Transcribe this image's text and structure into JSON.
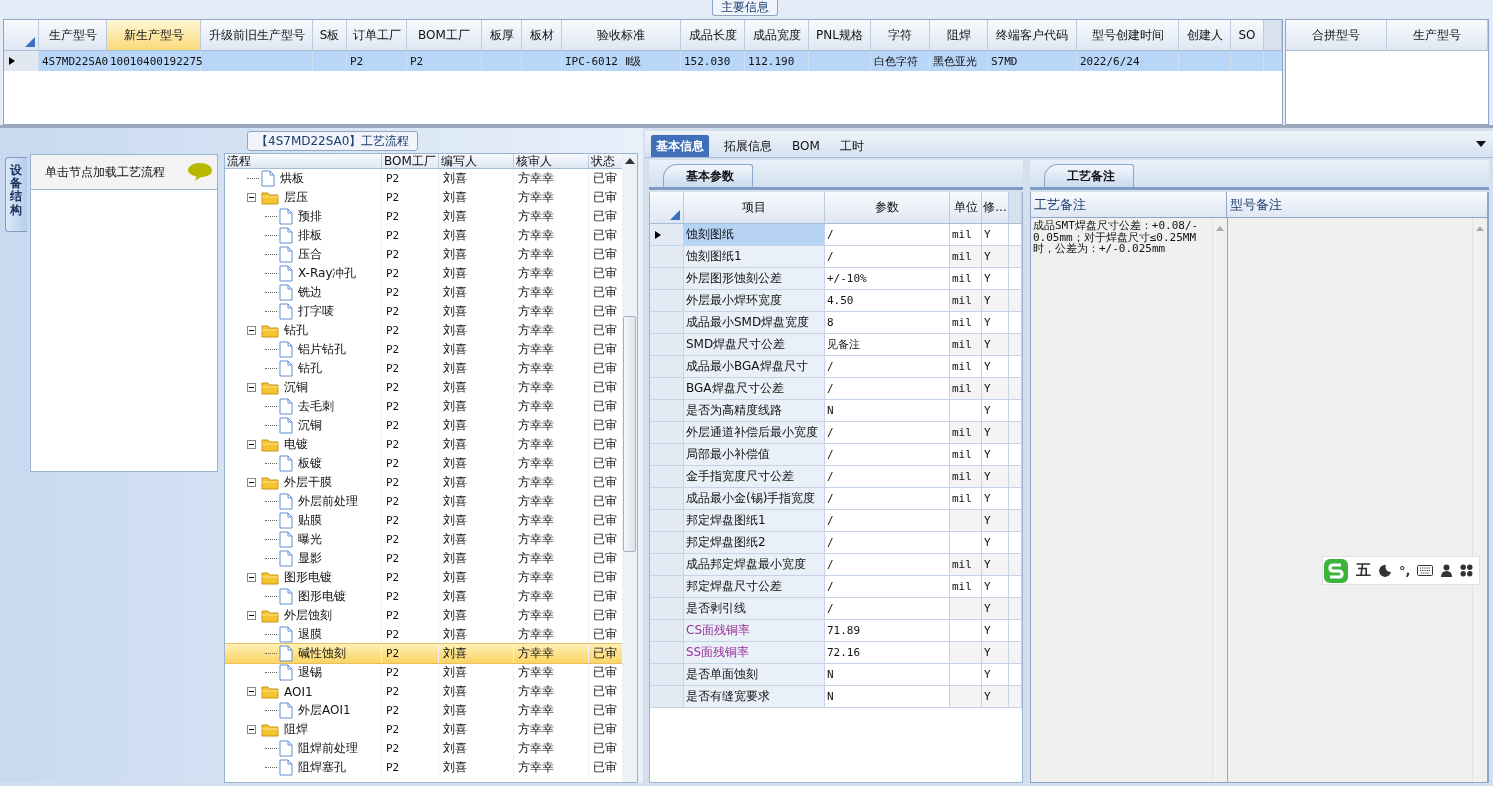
{
  "main_info": {
    "title": "主要信息",
    "columns": [
      {
        "label": "生产型号",
        "highlighted": false
      },
      {
        "label": "新生产型号",
        "highlighted": true
      },
      {
        "label": "升级前旧生产型号",
        "highlighted": false
      },
      {
        "label": "S板",
        "highlighted": false
      },
      {
        "label": "订单工厂",
        "highlighted": false
      },
      {
        "label": "BOM工厂",
        "highlighted": false
      },
      {
        "label": "板厚",
        "highlighted": false
      },
      {
        "label": "板材",
        "highlighted": false
      },
      {
        "label": "验收标准",
        "highlighted": false
      },
      {
        "label": "成品长度",
        "highlighted": false
      },
      {
        "label": "成品宽度",
        "highlighted": false
      },
      {
        "label": "PNL规格",
        "highlighted": false
      },
      {
        "label": "字符",
        "highlighted": false
      },
      {
        "label": "阻焊",
        "highlighted": false
      },
      {
        "label": "终端客户代码",
        "highlighted": false
      },
      {
        "label": "型号创建时间",
        "highlighted": false
      },
      {
        "label": "创建人",
        "highlighted": false
      },
      {
        "label": "SO",
        "highlighted": false
      }
    ],
    "rows": [
      {
        "selected": true,
        "cells": [
          "4S7MD22SA0",
          "10010400192275",
          null,
          null,
          "P2",
          "P2",
          null,
          null,
          "IPC-6012 Ⅱ级",
          "152.030",
          "112.190",
          null,
          "白色字符",
          "黑色亚光",
          "S7MD",
          "2022/6/24",
          null,
          null
        ]
      }
    ],
    "side_columns": [
      "合拼型号",
      "生产型号"
    ]
  },
  "left_tab": "设备结构",
  "process": {
    "title": "【4S7MD22SA0】工艺流程",
    "hint": "单击节点加载工艺流程",
    "columns": [
      "流程",
      "BOM工厂",
      "编写人",
      "核审人",
      "状态"
    ],
    "tree": [
      {
        "kind": "step",
        "label": "烘板",
        "bom": "P2",
        "writer": "刘喜",
        "reviewer": "方幸幸",
        "status": "已审",
        "selected": false
      },
      {
        "kind": "folder",
        "label": "层压",
        "bom": "P2",
        "writer": "刘喜",
        "reviewer": "方幸幸",
        "status": "已审",
        "selected": false,
        "expanded": true,
        "children": [
          {
            "kind": "step",
            "label": "预排",
            "bom": "P2",
            "writer": "刘喜",
            "reviewer": "方幸幸",
            "status": "已审",
            "selected": false
          },
          {
            "kind": "step",
            "label": "排板",
            "bom": "P2",
            "writer": "刘喜",
            "reviewer": "方幸幸",
            "status": "已审",
            "selected": false
          },
          {
            "kind": "step",
            "label": "压合",
            "bom": "P2",
            "writer": "刘喜",
            "reviewer": "方幸幸",
            "status": "已审",
            "selected": false
          },
          {
            "kind": "step",
            "label": "X-Ray冲孔",
            "bom": "P2",
            "writer": "刘喜",
            "reviewer": "方幸幸",
            "status": "已审",
            "selected": false
          },
          {
            "kind": "step",
            "label": "铣边",
            "bom": "P2",
            "writer": "刘喜",
            "reviewer": "方幸幸",
            "status": "已审",
            "selected": false
          },
          {
            "kind": "step",
            "label": "打字唛",
            "bom": "P2",
            "writer": "刘喜",
            "reviewer": "方幸幸",
            "status": "已审",
            "selected": false
          }
        ]
      },
      {
        "kind": "folder",
        "label": "钻孔",
        "bom": "P2",
        "writer": "刘喜",
        "reviewer": "方幸幸",
        "status": "已审",
        "selected": false,
        "expanded": true,
        "children": [
          {
            "kind": "step",
            "label": "铝片钻孔",
            "bom": "P2",
            "writer": "刘喜",
            "reviewer": "方幸幸",
            "status": "已审",
            "selected": false
          },
          {
            "kind": "step",
            "label": "钻孔",
            "bom": "P2",
            "writer": "刘喜",
            "reviewer": "方幸幸",
            "status": "已审",
            "selected": false
          }
        ]
      },
      {
        "kind": "folder",
        "label": "沉铜",
        "bom": "P2",
        "writer": "刘喜",
        "reviewer": "方幸幸",
        "status": "已审",
        "selected": false,
        "expanded": true,
        "children": [
          {
            "kind": "step",
            "label": "去毛刺",
            "bom": "P2",
            "writer": "刘喜",
            "reviewer": "方幸幸",
            "status": "已审",
            "selected": false
          },
          {
            "kind": "step",
            "label": "沉铜",
            "bom": "P2",
            "writer": "刘喜",
            "reviewer": "方幸幸",
            "status": "已审",
            "selected": false
          }
        ]
      },
      {
        "kind": "folder",
        "label": "电镀",
        "bom": "P2",
        "writer": "刘喜",
        "reviewer": "方幸幸",
        "status": "已审",
        "selected": false,
        "expanded": true,
        "children": [
          {
            "kind": "step",
            "label": "板镀",
            "bom": "P2",
            "writer": "刘喜",
            "reviewer": "方幸幸",
            "status": "已审",
            "selected": false
          }
        ]
      },
      {
        "kind": "folder",
        "label": "外层干膜",
        "bom": "P2",
        "writer": "刘喜",
        "reviewer": "方幸幸",
        "status": "已审",
        "selected": false,
        "expanded": true,
        "children": [
          {
            "kind": "step",
            "label": "外层前处理",
            "bom": "P2",
            "writer": "刘喜",
            "reviewer": "方幸幸",
            "status": "已审",
            "selected": false
          },
          {
            "kind": "step",
            "label": "贴膜",
            "bom": "P2",
            "writer": "刘喜",
            "reviewer": "方幸幸",
            "status": "已审",
            "selected": false
          },
          {
            "kind": "step",
            "label": "曝光",
            "bom": "P2",
            "writer": "刘喜",
            "reviewer": "方幸幸",
            "status": "已审",
            "selected": false
          },
          {
            "kind": "step",
            "label": "显影",
            "bom": "P2",
            "writer": "刘喜",
            "reviewer": "方幸幸",
            "status": "已审",
            "selected": false
          }
        ]
      },
      {
        "kind": "folder",
        "label": "图形电镀",
        "bom": "P2",
        "writer": "刘喜",
        "reviewer": "方幸幸",
        "status": "已审",
        "selected": false,
        "expanded": true,
        "children": [
          {
            "kind": "step",
            "label": "图形电镀",
            "bom": "P2",
            "writer": "刘喜",
            "reviewer": "方幸幸",
            "status": "已审",
            "selected": false
          }
        ]
      },
      {
        "kind": "folder",
        "label": "外层蚀刻",
        "bom": "P2",
        "writer": "刘喜",
        "reviewer": "方幸幸",
        "status": "已审",
        "selected": false,
        "expanded": true,
        "children": [
          {
            "kind": "step",
            "label": "退膜",
            "bom": "P2",
            "writer": "刘喜",
            "reviewer": "方幸幸",
            "status": "已审",
            "selected": false
          },
          {
            "kind": "step",
            "label": "碱性蚀刻",
            "bom": "P2",
            "writer": "刘喜",
            "reviewer": "方幸幸",
            "status": "已审",
            "selected": true
          },
          {
            "kind": "step",
            "label": "退锡",
            "bom": "P2",
            "writer": "刘喜",
            "reviewer": "方幸幸",
            "status": "已审",
            "selected": false
          }
        ]
      },
      {
        "kind": "folder",
        "label": "AOI1",
        "bom": "P2",
        "writer": "刘喜",
        "reviewer": "方幸幸",
        "status": "已审",
        "selected": false,
        "expanded": true,
        "children": [
          {
            "kind": "step",
            "label": "外层AOI1",
            "bom": "P2",
            "writer": "刘喜",
            "reviewer": "方幸幸",
            "status": "已审",
            "selected": false
          }
        ]
      },
      {
        "kind": "folder",
        "label": "阻焊",
        "bom": "P2",
        "writer": "刘喜",
        "reviewer": "方幸幸",
        "status": "已审",
        "selected": false,
        "expanded": true,
        "children": [
          {
            "kind": "step",
            "label": "阻焊前处理",
            "bom": "P2",
            "writer": "刘喜",
            "reviewer": "方幸幸",
            "status": "已审",
            "selected": false
          },
          {
            "kind": "step",
            "label": "阻焊塞孔",
            "bom": "P2",
            "writer": "刘喜",
            "reviewer": "方幸幸",
            "status": "已审",
            "selected": false
          }
        ]
      }
    ]
  },
  "tabs": [
    {
      "label": "基本信息",
      "selected": true
    },
    {
      "label": "拓展信息",
      "selected": false
    },
    {
      "label": "BOM",
      "selected": false
    },
    {
      "label": "工时",
      "selected": false
    }
  ],
  "params": {
    "tab": "基本参数",
    "columns": [
      "项目",
      "参数",
      "单位",
      "修..."
    ],
    "rows": [
      {
        "item": "蚀刻图纸",
        "value": "/",
        "unit": "mil",
        "flag": "Y",
        "selected": true
      },
      {
        "item": "蚀刻图纸1",
        "value": "/",
        "unit": "mil",
        "flag": "Y",
        "selected": false
      },
      {
        "item": "外层图形蚀刻公差",
        "value": "+/-10%",
        "unit": "mil",
        "flag": "Y",
        "selected": false
      },
      {
        "item": "外层最小焊环宽度",
        "value": "4.50",
        "unit": "mil",
        "flag": "Y",
        "selected": false
      },
      {
        "item": "成品最小SMD焊盘宽度",
        "value": "8",
        "unit": "mil",
        "flag": "Y",
        "selected": false
      },
      {
        "item": "SMD焊盘尺寸公差",
        "value": "见备注",
        "unit": "mil",
        "flag": "Y",
        "selected": false
      },
      {
        "item": "成品最小BGA焊盘尺寸",
        "value": "/",
        "unit": "mil",
        "flag": "Y",
        "selected": false
      },
      {
        "item": "BGA焊盘尺寸公差",
        "value": "/",
        "unit": "mil",
        "flag": "Y",
        "selected": false
      },
      {
        "item": "是否为高精度线路",
        "value": "N",
        "flag": "Y",
        "selected": false
      },
      {
        "item": "外层通道补偿后最小宽度",
        "value": "/",
        "unit": "mil",
        "flag": "Y",
        "selected": false
      },
      {
        "item": "局部最小补偿值",
        "value": "/",
        "unit": "mil",
        "flag": "Y",
        "selected": false
      },
      {
        "item": "金手指宽度尺寸公差",
        "value": "/",
        "unit": "mil",
        "flag": "Y",
        "selected": false
      },
      {
        "item": "成品最小金(锡)手指宽度",
        "value": "/",
        "unit": "mil",
        "flag": "Y",
        "selected": false
      },
      {
        "item": "邦定焊盘图纸1",
        "value": "/",
        "flag": "Y",
        "selected": false
      },
      {
        "item": "邦定焊盘图纸2",
        "value": "/",
        "flag": "Y",
        "selected": false
      },
      {
        "item": "成品邦定焊盘最小宽度",
        "value": "/",
        "unit": "mil",
        "flag": "Y",
        "selected": false
      },
      {
        "item": "邦定焊盘尺寸公差",
        "value": "/",
        "unit": "mil",
        "flag": "Y",
        "selected": false
      },
      {
        "item": "是否剥引线",
        "value": "/",
        "flag": "Y",
        "selected": false
      },
      {
        "item": "CS面残铜率",
        "value": "71.89",
        "flag": "Y",
        "selected": false,
        "color": "#993399"
      },
      {
        "item": "SS面残铜率",
        "value": "72.16",
        "flag": "Y",
        "selected": false,
        "color": "#993399"
      },
      {
        "item": "是否单面蚀刻",
        "value": "N",
        "flag": "Y",
        "selected": false
      },
      {
        "item": "是否有缝宽要求",
        "value": "N",
        "flag": "Y",
        "selected": false
      }
    ]
  },
  "notes": {
    "tab": "工艺备注",
    "columns": [
      "工艺备注",
      "型号备注"
    ],
    "process_note": "成品SMT焊盘尺寸公差：+0.08/-0.05mm；对于焊盘尺寸≤0.25MM时，公差为：+/-0.025mm"
  },
  "ime": {
    "mode": "五",
    "punct": "°,"
  }
}
